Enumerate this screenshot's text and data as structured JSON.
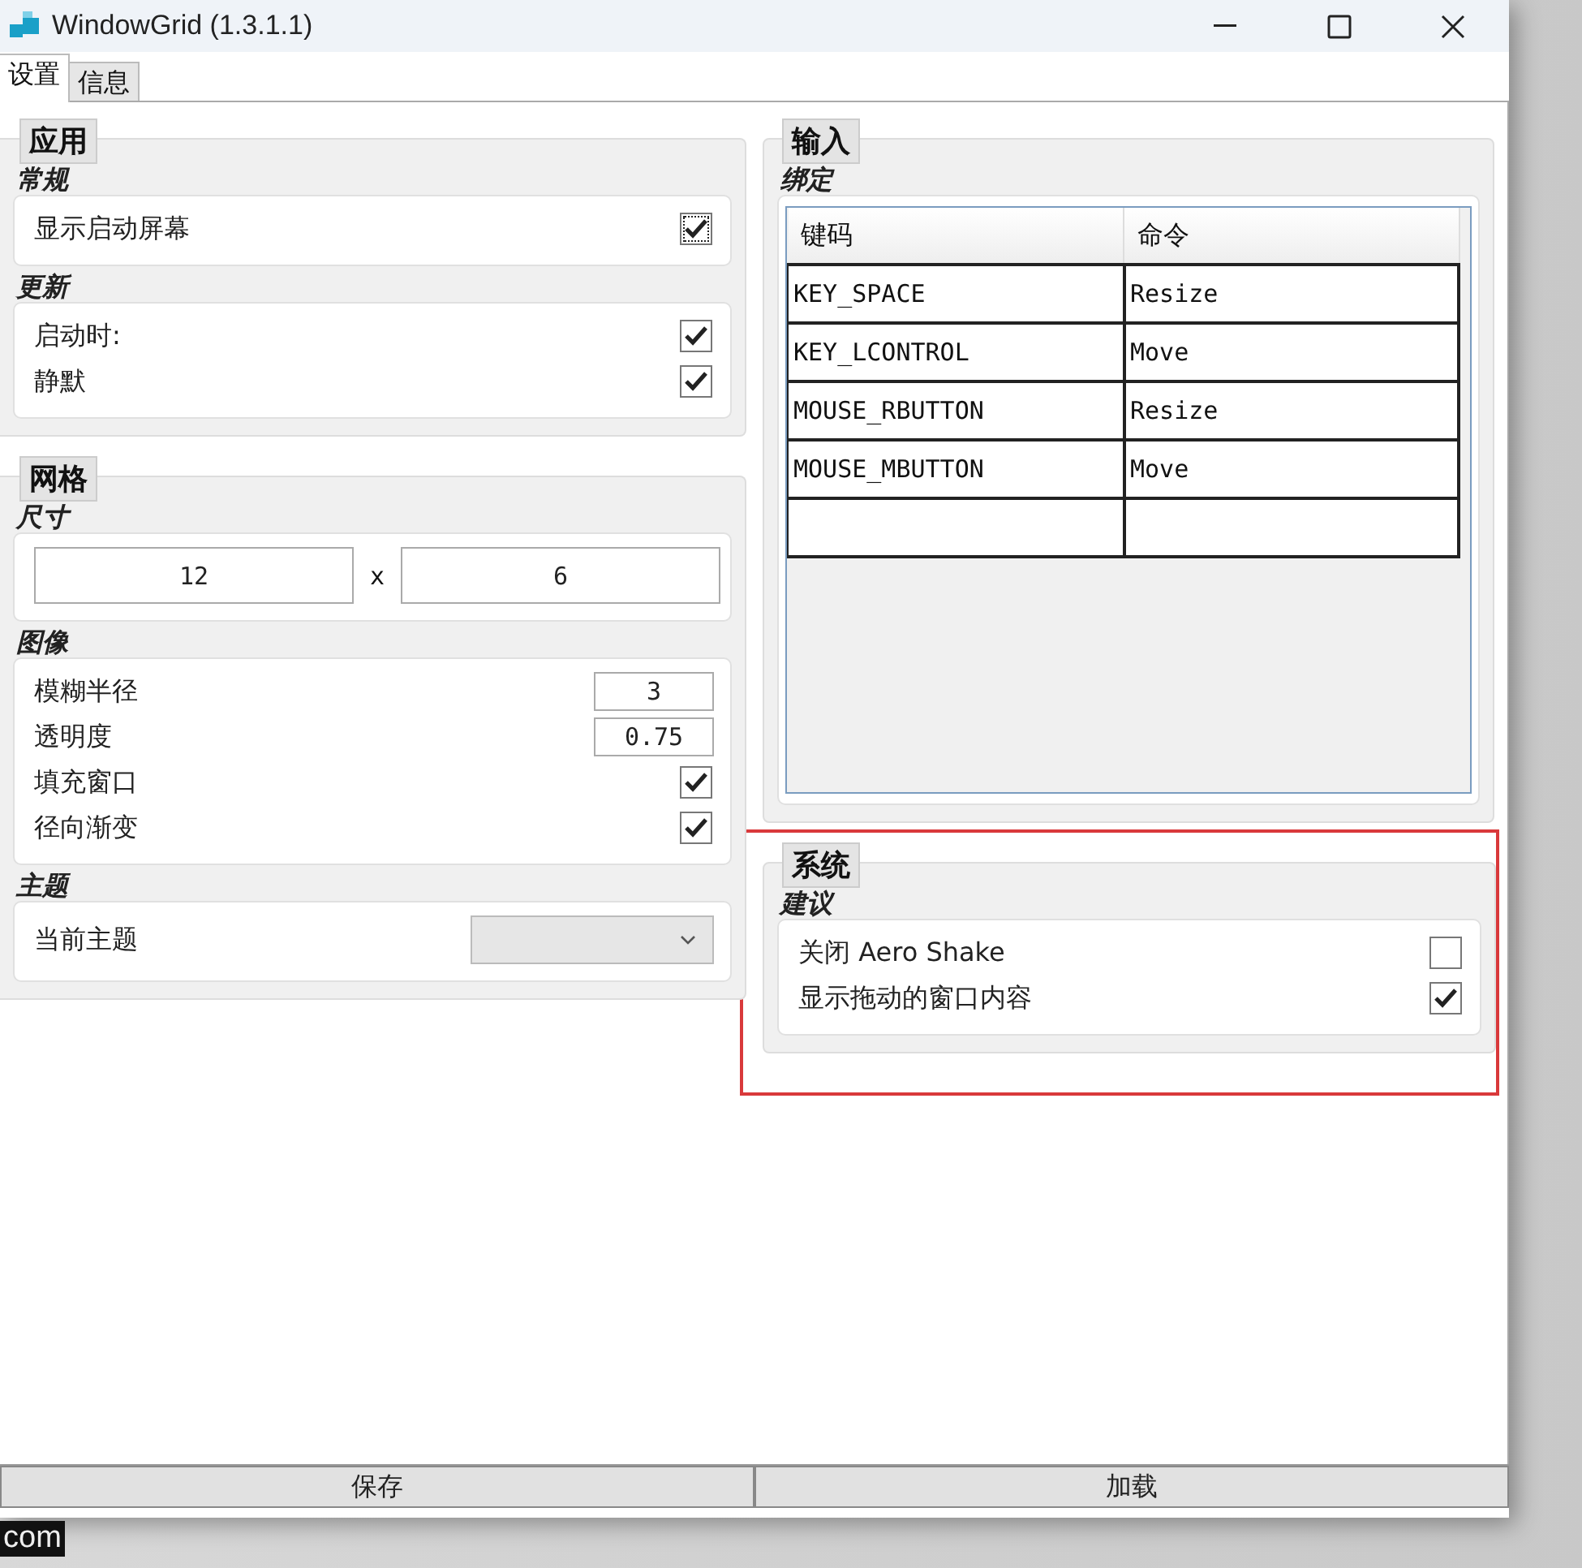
{
  "window": {
    "title": "WindowGrid (1.3.1.1)"
  },
  "tabs": [
    {
      "label": "设置",
      "selected": true
    },
    {
      "label": "信息",
      "selected": false
    }
  ],
  "left_groups": [
    {
      "title": "应用",
      "sections": [
        {
          "title": "常规",
          "rows": [
            {
              "kind": "checkbox",
              "label": "显示启动屏幕",
              "checked": true,
              "focused": true
            }
          ]
        },
        {
          "title": "更新",
          "rows": [
            {
              "kind": "checkbox",
              "label": "启动时:",
              "checked": true,
              "focused": false
            },
            {
              "kind": "checkbox",
              "label": "静默",
              "checked": true,
              "focused": false
            }
          ]
        }
      ]
    },
    {
      "title": "网格",
      "sections": [
        {
          "title": "尺寸",
          "rows": [
            {
              "kind": "pair",
              "values": [
                "12",
                "6"
              ],
              "separator": "x"
            }
          ]
        },
        {
          "title": "图像",
          "rows": [
            {
              "kind": "number",
              "label": "模糊半径",
              "value": "3"
            },
            {
              "kind": "number",
              "label": "透明度",
              "value": "0.75"
            },
            {
              "kind": "checkbox",
              "label": "填充窗口",
              "checked": true,
              "focused": false
            },
            {
              "kind": "checkbox",
              "label": "径向渐变",
              "checked": true,
              "focused": false
            }
          ]
        },
        {
          "title": "主题",
          "rows": [
            {
              "kind": "dropdown",
              "label": "当前主题"
            }
          ]
        }
      ]
    }
  ],
  "right_groups": [
    {
      "title": "输入",
      "highlighted": false,
      "sections": [
        {
          "title": "绑定",
          "rows": [
            {
              "kind": "table",
              "columns": [
                "键码",
                "命令"
              ],
              "cells": [
                [
                  "KEY_SPACE",
                  "Resize"
                ],
                [
                  "KEY_LCONTROL",
                  "Move"
                ],
                [
                  "MOUSE_RBUTTON",
                  "Resize"
                ],
                [
                  "MOUSE_MBUTTON",
                  "Move"
                ]
              ]
            }
          ]
        }
      ]
    },
    {
      "title": "系统",
      "highlighted": true,
      "sections": [
        {
          "title": "建议",
          "rows": [
            {
              "kind": "checkbox",
              "label": "关闭 Aero Shake",
              "checked": false,
              "focused": false
            },
            {
              "kind": "checkbox",
              "label": "显示拖动的窗口内容",
              "checked": true,
              "focused": false
            }
          ]
        }
      ]
    }
  ],
  "buttons": [
    "保存",
    "加载"
  ],
  "desktop_text": "com"
}
